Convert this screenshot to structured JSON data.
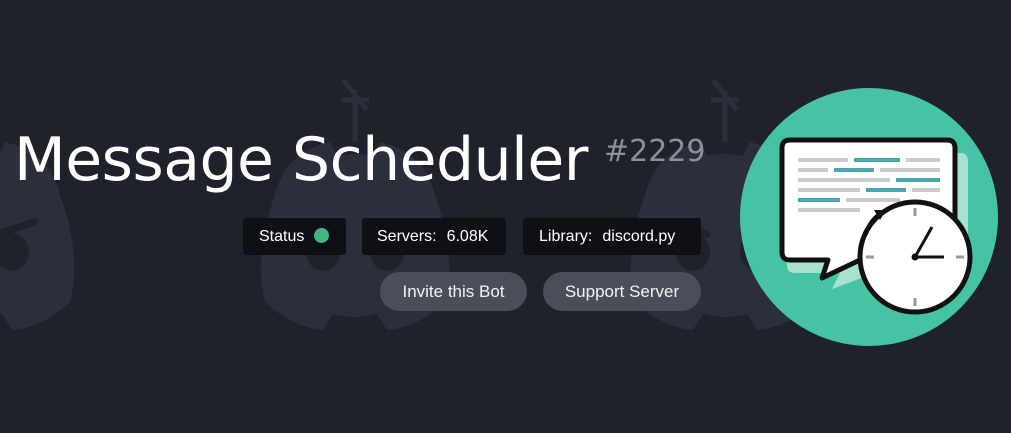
{
  "bot": {
    "name": "Message Scheduler",
    "id_tag": "#2229"
  },
  "stats": {
    "status_label": "Status",
    "status_color": "#43b581",
    "servers_label": "Servers:",
    "servers_value": "6.08K",
    "library_label": "Library:",
    "library_value": "discord.py"
  },
  "actions": {
    "invite_label": "Invite this Bot",
    "support_label": "Support Server"
  },
  "avatar": {
    "icon": "message-scheduler-avatar",
    "bg_color": "#46c2a4"
  },
  "background": {
    "icon": "discord-logo-pattern"
  },
  "colors": {
    "page_bg": "#1f212b",
    "stat_bg": "#0f1015",
    "button_bg": "#4b4e58",
    "id_color": "#8d9096"
  }
}
